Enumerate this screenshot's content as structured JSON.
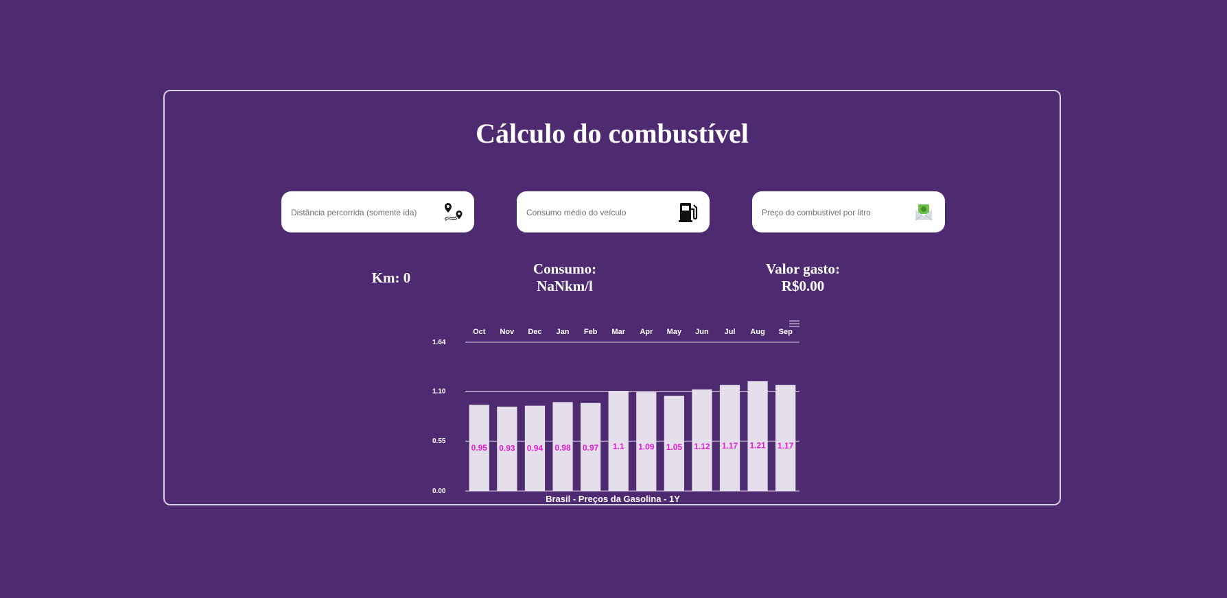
{
  "title": "Cálculo do combustível",
  "inputs": [
    {
      "placeholder": "Distância percorrida (somente ida)",
      "value": "",
      "icon": "map-route-icon"
    },
    {
      "placeholder": "Consumo médio do veículo",
      "value": "",
      "icon": "fuel-pump-icon"
    },
    {
      "placeholder": "Preço do combustível por litro",
      "value": "",
      "icon": "money-envelope-icon"
    }
  ],
  "results": {
    "km": "Km: 0",
    "consumo_label": "Consumo:",
    "consumo_value": "NaNkm/l",
    "valor_label": "Valor gasto:",
    "valor_value": "R$0.00"
  },
  "colors": {
    "background": "#4e2b71",
    "bar": "#e4dfea",
    "data_label": "#e21ad1",
    "text": "#ffffff"
  },
  "chart_data": {
    "type": "bar",
    "title": "Brasil - Preços da Gasolina - 1Y",
    "categories": [
      "Oct",
      "Nov",
      "Dec",
      "Jan",
      "Feb",
      "Mar",
      "Apr",
      "May",
      "Jun",
      "Jul",
      "Aug",
      "Sep"
    ],
    "values": [
      0.95,
      0.93,
      0.94,
      0.98,
      0.97,
      1.1,
      1.09,
      1.05,
      1.12,
      1.17,
      1.21,
      1.17
    ],
    "data_labels": [
      "0.95",
      "0.93",
      "0.94",
      "0.98",
      "0.97",
      "1.1",
      "1.09",
      "1.05",
      "1.12",
      "1.17",
      "1.21",
      "1.17"
    ],
    "y_ticks": [
      0,
      0.55,
      1.1,
      1.64
    ],
    "y_tick_labels": [
      "0.00",
      "0.55",
      "1.10",
      "1.64"
    ],
    "ylim": [
      0,
      1.64
    ],
    "x_axis_position": "top",
    "grid": true,
    "menu_icon": "hamburger-menu-icon"
  }
}
